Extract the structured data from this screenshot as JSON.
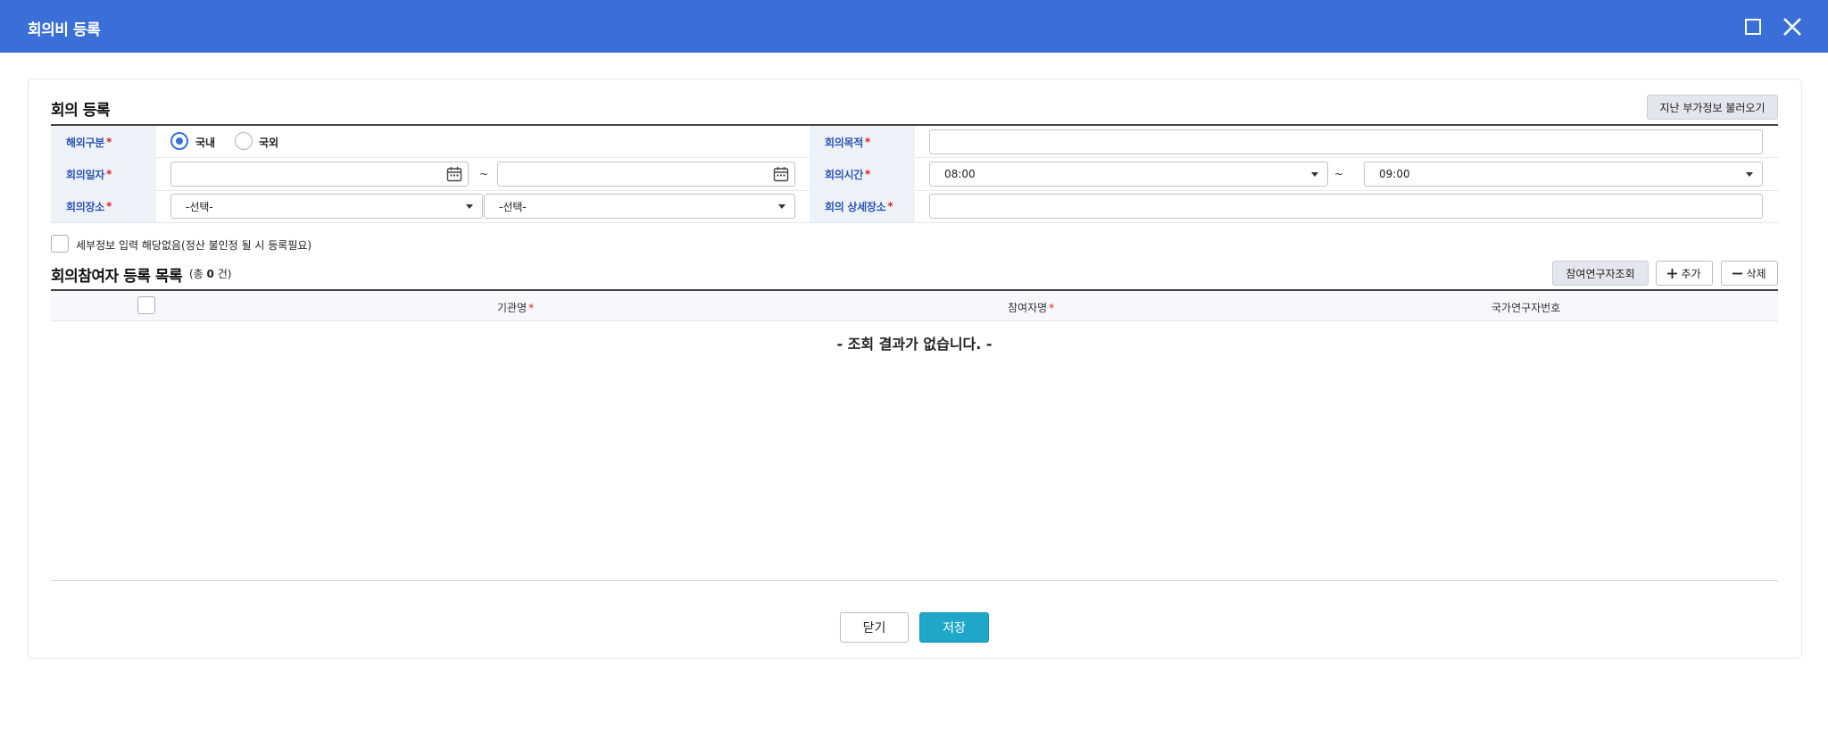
{
  "window": {
    "title": "회의비 등록"
  },
  "meeting": {
    "section_title": "회의 등록",
    "load_prev_button": "지난 부가정보 불러오기",
    "fields": {
      "domestic_label": "해외구분",
      "domestic_options": [
        "국내",
        "국외"
      ],
      "purpose_label": "회의목적",
      "purpose_value": "",
      "date_label": "회의일자",
      "date_from": "",
      "date_to": "",
      "time_label": "회의시간",
      "time_from": "08:00",
      "time_to": "09:00",
      "place_label": "회의장소",
      "place_select_1": "-선택-",
      "place_select_2": "-선택-",
      "detail_place_label": "회의 상세장소",
      "detail_place_value": "",
      "tilde": "~",
      "required_mark": "*"
    },
    "no_detail_checkbox_label": "세부정보 입력 해당없음(정산 불인정 될 시 등록필요)"
  },
  "participants": {
    "section_title": "회의참여자 등록 목록",
    "count_prefix": "(총 ",
    "count": "0",
    "count_suffix": " 건)",
    "search_button": "참여연구자조회",
    "add_button": "추가",
    "delete_button": "삭제",
    "columns": [
      "기관명",
      "참여자명",
      "국가연구자번호"
    ],
    "empty_text": "- 조회 결과가 없습니다. -"
  },
  "footer": {
    "close_button": "닫기",
    "save_button": "저장"
  },
  "colors": {
    "titlebar": "#3a6fd8",
    "label_text": "#2d56b4",
    "required": "#e02020",
    "save_button": "#1fa7c9"
  }
}
